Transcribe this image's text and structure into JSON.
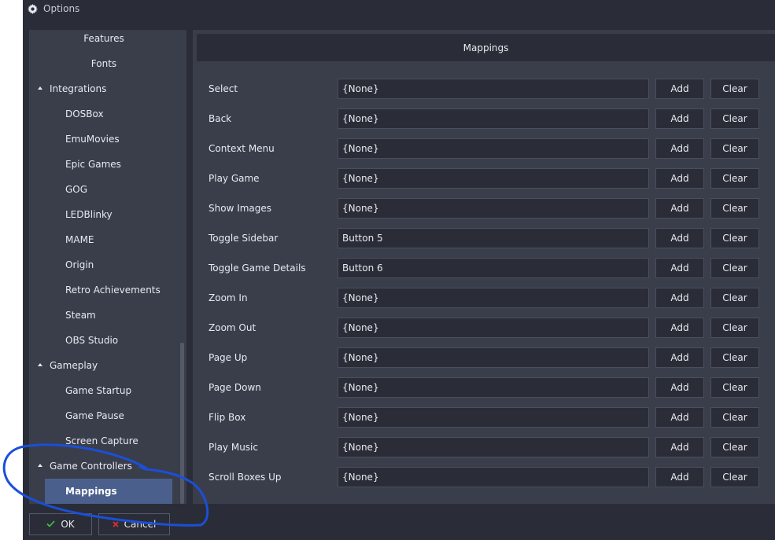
{
  "window": {
    "title": "Options",
    "icon": "gear-icon"
  },
  "sidebar": {
    "items": [
      {
        "label": "Features",
        "level": "center",
        "top": 0
      },
      {
        "label": "Fonts",
        "level": "center"
      },
      {
        "label": "Integrations",
        "level": "l1",
        "expanded": true
      },
      {
        "label": "DOSBox",
        "level": "l2"
      },
      {
        "label": "EmuMovies",
        "level": "l2"
      },
      {
        "label": "Epic Games",
        "level": "l2"
      },
      {
        "label": "GOG",
        "level": "l2"
      },
      {
        "label": "LEDBlinky",
        "level": "l2"
      },
      {
        "label": "MAME",
        "level": "l2"
      },
      {
        "label": "Origin",
        "level": "l2"
      },
      {
        "label": "Retro Achievements",
        "level": "l2"
      },
      {
        "label": "Steam",
        "level": "l2"
      },
      {
        "label": "OBS Studio",
        "level": "l2"
      },
      {
        "label": "Gameplay",
        "level": "l1",
        "expanded": true
      },
      {
        "label": "Game Startup",
        "level": "l2"
      },
      {
        "label": "Game Pause",
        "level": "l2"
      },
      {
        "label": "Screen Capture",
        "level": "l2"
      },
      {
        "label": "Game Controllers",
        "level": "l1",
        "expanded": true
      },
      {
        "label": "Mappings",
        "level": "l2",
        "selected": true
      }
    ]
  },
  "panel": {
    "header": "Mappings",
    "add_label": "Add",
    "clear_label": "Clear",
    "mappings": [
      {
        "label": "Select",
        "value": "{None}"
      },
      {
        "label": "Back",
        "value": "{None}"
      },
      {
        "label": "Context Menu",
        "value": "{None}"
      },
      {
        "label": "Play Game",
        "value": "{None}"
      },
      {
        "label": "Show Images",
        "value": "{None}"
      },
      {
        "label": "Toggle Sidebar",
        "value": "Button 5"
      },
      {
        "label": "Toggle Game Details",
        "value": "Button 6"
      },
      {
        "label": "Zoom In",
        "value": "{None}"
      },
      {
        "label": "Zoom Out",
        "value": "{None}"
      },
      {
        "label": "Page Up",
        "value": "{None}"
      },
      {
        "label": "Page Down",
        "value": "{None}"
      },
      {
        "label": "Flip Box",
        "value": "{None}"
      },
      {
        "label": "Play Music",
        "value": "{None}"
      },
      {
        "label": "Scroll Boxes Up",
        "value": "{None}"
      }
    ]
  },
  "footer": {
    "ok_label": "OK",
    "ok_icon": "checkmark-icon",
    "cancel_label": "Cancel",
    "cancel_icon": "close-icon"
  },
  "colors": {
    "window_bg": "#2a2d37",
    "panel_bg": "#3a3e4b",
    "selection": "#4a5f8c",
    "ok_check": "#3ec93e",
    "cancel_x": "#e03030",
    "annotation": "#1b4fd8"
  }
}
